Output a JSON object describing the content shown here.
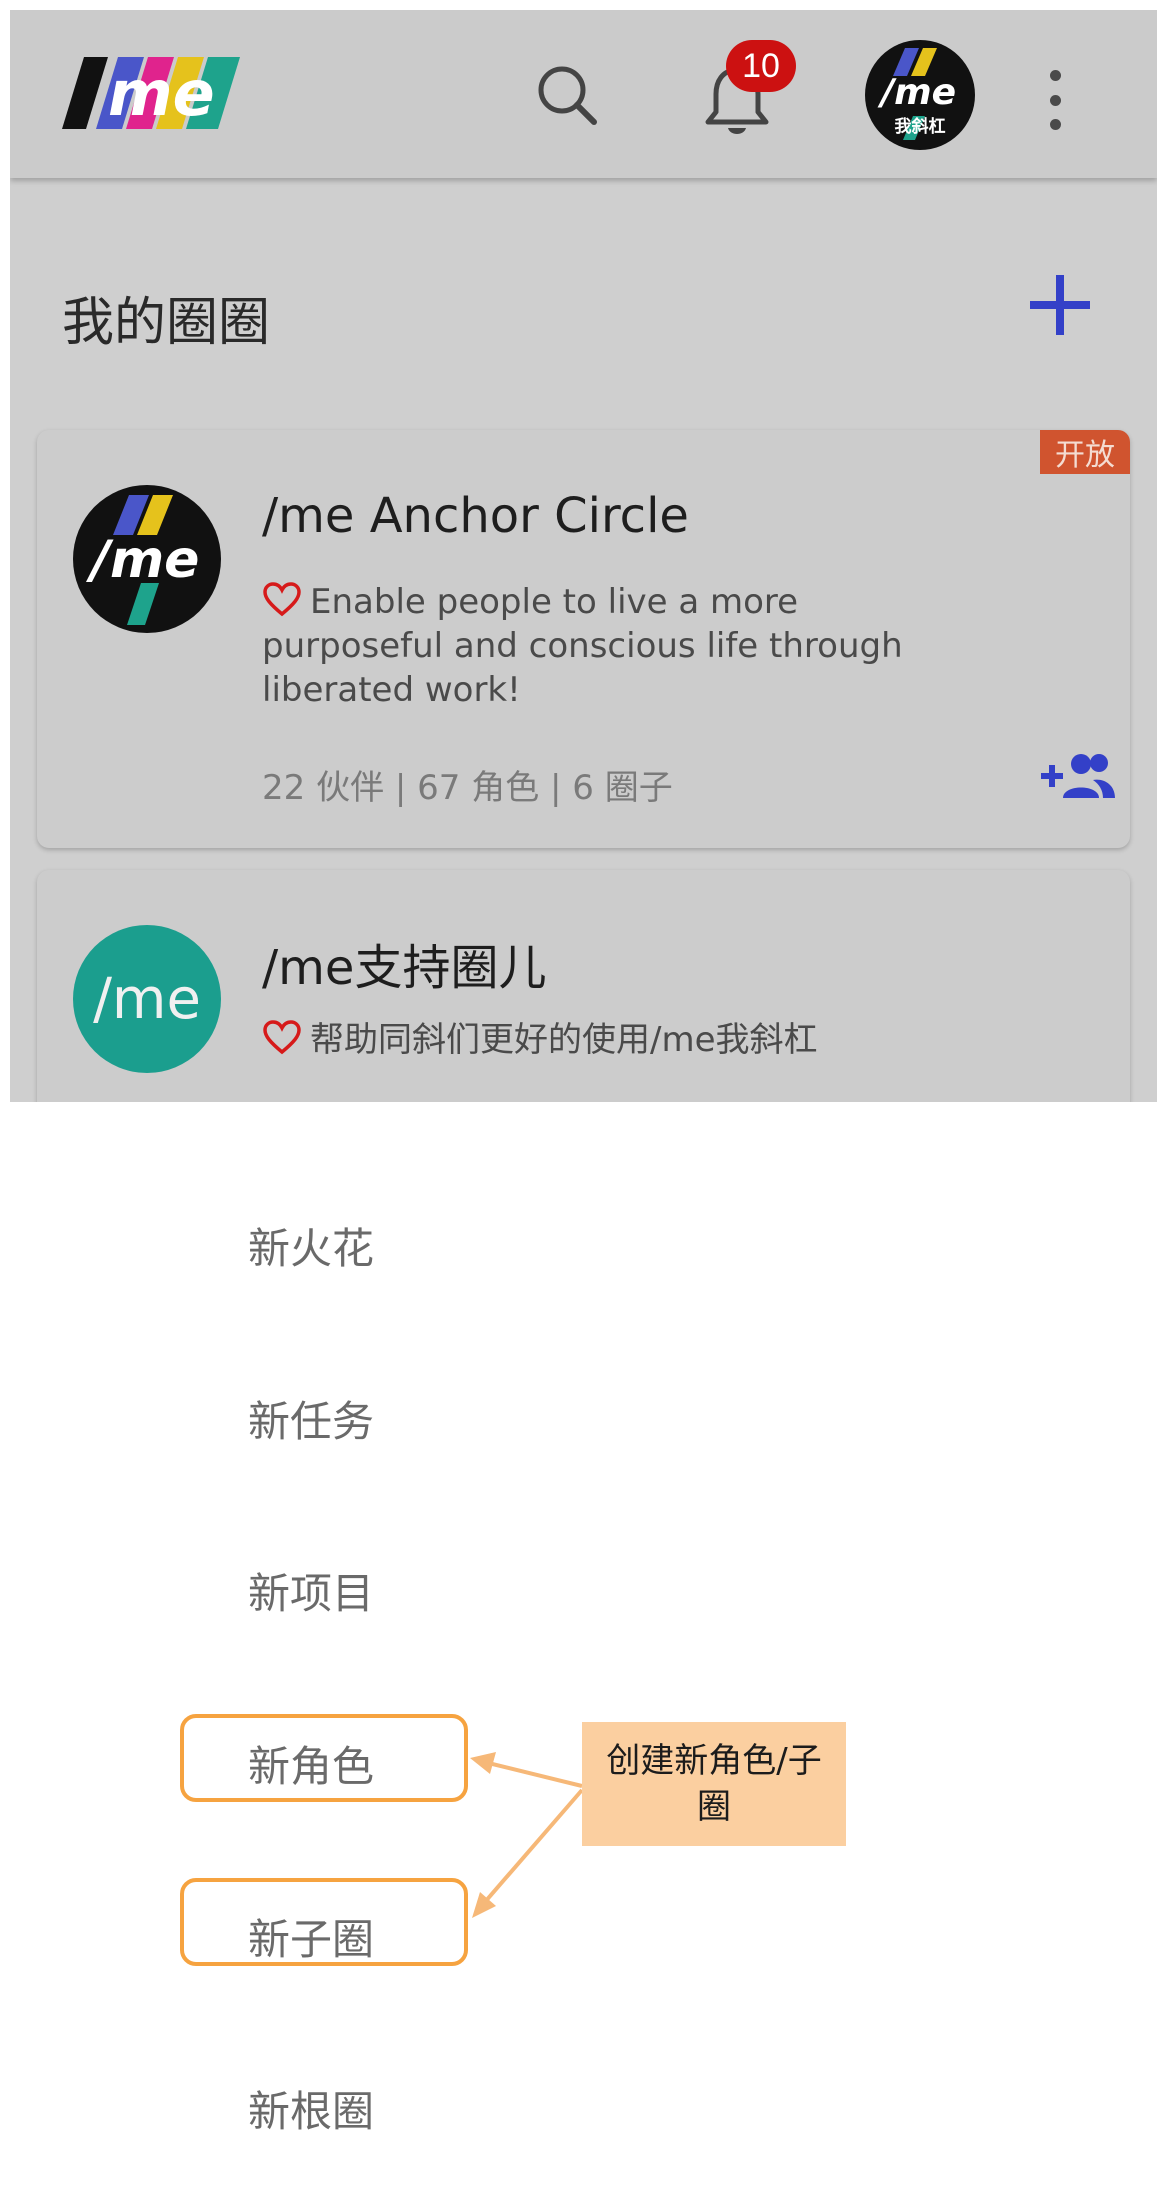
{
  "header": {
    "notification_count": "10",
    "avatar_caption": "我斜杠"
  },
  "circles": {
    "title": "我的圈圈"
  },
  "cards": [
    {
      "title": "/me Anchor Circle",
      "tag": "开放",
      "purpose": "Enable people to live a more purposeful and conscious life through liberated work!",
      "stats": "22 伙伴 | 67 角色 | 6 圈子"
    },
    {
      "title": "/me支持圈儿",
      "avatar_text": "/me",
      "purpose": "帮助同斜们更好的使用/me我斜杠"
    }
  ],
  "menu": {
    "items": [
      "新火花",
      "新任务",
      "新项目",
      "新角色",
      "新子圈",
      "新根圈"
    ]
  },
  "annotation": {
    "callout": "创建新角色/子圈"
  },
  "colors": {
    "accent_blue": "#3340c8",
    "heart_red": "#d61a1a",
    "tag_orange": "#d0542f",
    "teal": "#1b9e8e",
    "highlight_orange": "#f6a340",
    "callout_fill": "#fbcfa0"
  }
}
